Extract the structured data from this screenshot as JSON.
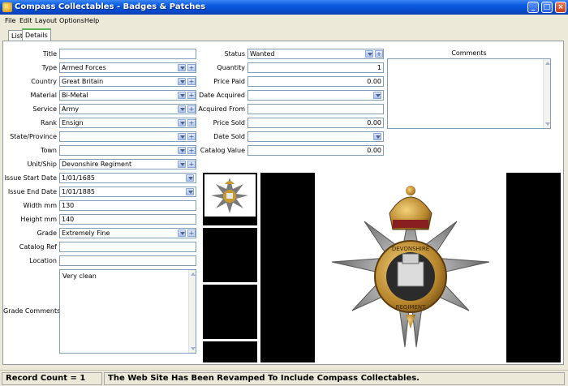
{
  "window": {
    "title": "Compass Collectables - Badges & Patches",
    "min": "_",
    "max": "□",
    "close": "×"
  },
  "menu": [
    "File",
    "Edit",
    "Layout",
    "Options",
    "Help"
  ],
  "tabs": {
    "list": "List",
    "details": "Details"
  },
  "left_fields": {
    "title": {
      "label": "Title",
      "value": ""
    },
    "type": {
      "label": "Type",
      "value": "Armed Forces"
    },
    "country": {
      "label": "Country",
      "value": "Great Britain"
    },
    "material": {
      "label": "Material",
      "value": "Bi-Metal"
    },
    "service": {
      "label": "Service",
      "value": "Army"
    },
    "rank": {
      "label": "Rank",
      "value": "Ensign"
    },
    "state": {
      "label": "State/Province",
      "value": ""
    },
    "town": {
      "label": "Town",
      "value": ""
    },
    "unit": {
      "label": "Unit/Ship",
      "value": "Devonshire Regiment"
    },
    "issue_start": {
      "label": "Issue Start Date",
      "value": "1/01/1685"
    },
    "issue_end": {
      "label": "Issue End Date",
      "value": "1/01/1885"
    },
    "width": {
      "label": "Width mm",
      "value": "130"
    },
    "height": {
      "label": "Height mm",
      "value": "140"
    },
    "grade": {
      "label": "Grade",
      "value": "Extremely Fine"
    },
    "catalog_ref": {
      "label": "Catalog Ref",
      "value": ""
    },
    "location": {
      "label": "Location",
      "value": ""
    },
    "grade_comments": {
      "label": "Grade Comments",
      "value": "Very clean"
    }
  },
  "mid_fields": {
    "status": {
      "label": "Status",
      "value": "Wanted"
    },
    "quantity": {
      "label": "Quantity",
      "value": "1"
    },
    "price_paid": {
      "label": "Price Paid",
      "value": "0.00"
    },
    "date_acquired": {
      "label": "Date Acquired",
      "value": ""
    },
    "acquired_from": {
      "label": "Acquired From",
      "value": ""
    },
    "price_sold": {
      "label": "Price Sold",
      "value": "0.00"
    },
    "date_sold": {
      "label": "Date Sold",
      "value": ""
    },
    "catalog_value": {
      "label": "Catalog Value",
      "value": "0.00"
    }
  },
  "comments": {
    "label": "Comments",
    "value": ""
  },
  "image": {
    "text_top": "DEVONSHIRE",
    "text_bottom": "REGIMENT"
  },
  "status": {
    "record_count": "Record Count = 1",
    "message": "The Web Site Has Been Revamped To Include Compass Collectables."
  },
  "colors": {
    "titlebar": "#0a5be0",
    "tab_accent": "#5ab552",
    "border": "#7f9db9"
  },
  "icons": {
    "dropdown": "chevron-down-icon",
    "add": "add-icon",
    "app": "app-icon"
  }
}
